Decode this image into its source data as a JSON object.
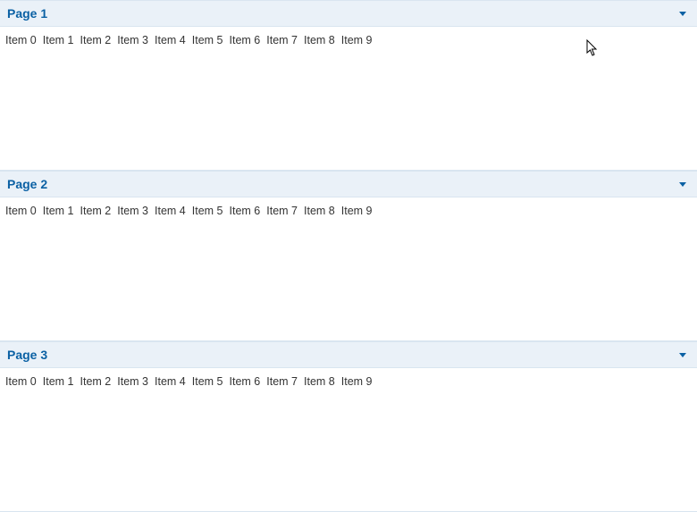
{
  "panels": [
    {
      "title": "Page 1",
      "items": [
        "Item 0",
        "Item 1",
        "Item 2",
        "Item 3",
        "Item 4",
        "Item 5",
        "Item 6",
        "Item 7",
        "Item 8",
        "Item 9"
      ]
    },
    {
      "title": "Page 2",
      "items": [
        "Item 0",
        "Item 1",
        "Item 2",
        "Item 3",
        "Item 4",
        "Item 5",
        "Item 6",
        "Item 7",
        "Item 8",
        "Item 9"
      ]
    },
    {
      "title": "Page 3",
      "items": [
        "Item 0",
        "Item 1",
        "Item 2",
        "Item 3",
        "Item 4",
        "Item 5",
        "Item 6",
        "Item 7",
        "Item 8",
        "Item 9"
      ]
    }
  ]
}
